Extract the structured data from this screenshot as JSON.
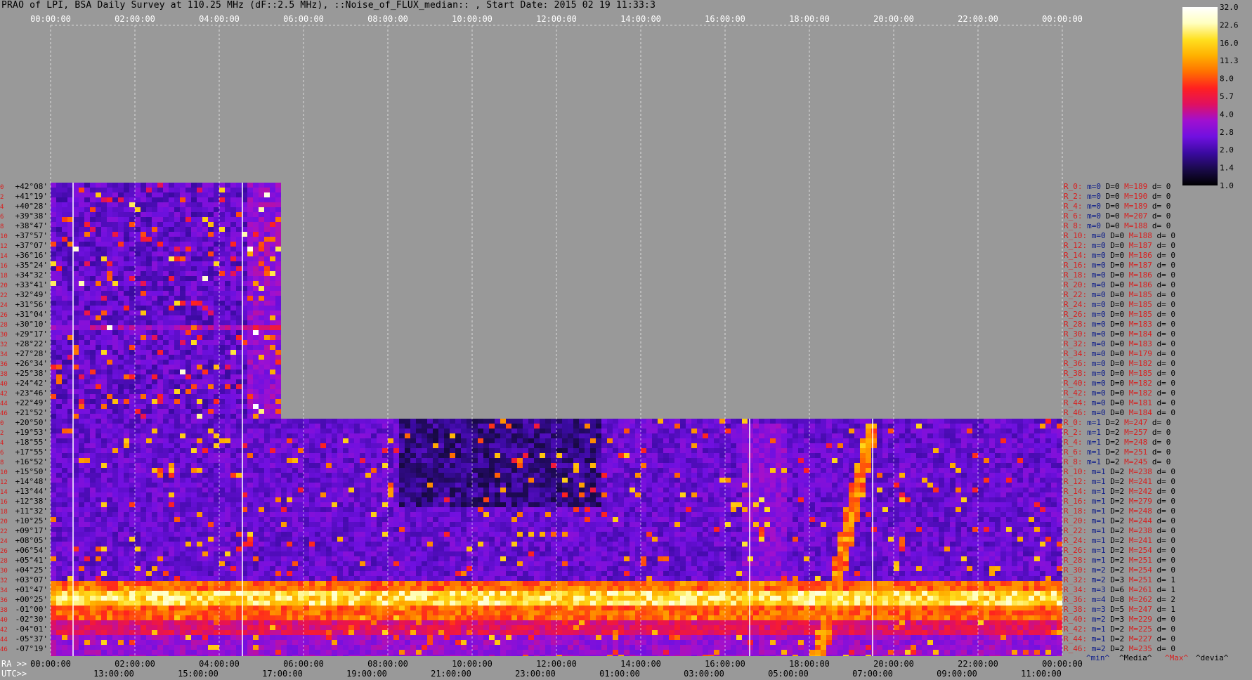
{
  "title": "PRAO of LPI, BSA Daily Survey at 110.25 MHz (dF::2.5 MHz), ::Noise_of_FLUX_median:: , Start Date: 2015 02 19 11:33:3",
  "top_time_labels": [
    "00:00:00",
    "02:00:00",
    "04:00:00",
    "06:00:00",
    "08:00:00",
    "10:00:00",
    "12:00:00",
    "14:00:00",
    "16:00:00",
    "18:00:00",
    "20:00:00",
    "22:00:00",
    "00:00:00"
  ],
  "ra_prefix": "RA >>",
  "ra_labels": [
    "00:00:00",
    "02:00:00",
    "04:00:00",
    "06:00:00",
    "08:00:00",
    "10:00:00",
    "12:00:00",
    "14:00:00",
    "16:00:00",
    "18:00:00",
    "20:00:00",
    "22:00:00",
    "00:00:00"
  ],
  "utc_prefix": "UTC>>",
  "utc_labels": [
    "13:00:00",
    "15:00:00",
    "17:00:00",
    "19:00:00",
    "21:00:00",
    "23:00:00",
    "01:00:00",
    "03:00:00",
    "05:00:00",
    "07:00:00",
    "09:00:00",
    "11:00:00"
  ],
  "colorbar": {
    "ticks": [
      "32.0",
      "22.6",
      "16.0",
      "11.3",
      "8.0",
      "5.7",
      "4.0",
      "2.8",
      "2.0",
      "1.4",
      "1.0"
    ],
    "stops": [
      "#000000",
      "#1a0a4a",
      "#3a0aa0",
      "#7010e0",
      "#a010d0",
      "#e01060",
      "#ff2020",
      "#ff7000",
      "#ffb000",
      "#ffe020",
      "#ffffc0",
      "#ffffff"
    ]
  },
  "declinations_upper": [
    "+42°08'",
    "+41°19'",
    "+40°28'",
    "+39°38'",
    "+38°47'",
    "+37°57'",
    "+37°07'",
    "+36°16'",
    "+35°24'",
    "+34°32'",
    "+33°41'",
    "+32°49'",
    "+31°56'",
    "+31°04'",
    "+30°10'",
    "+29°17'",
    "+28°22'",
    "+27°28'",
    "+26°34'",
    "+25°38'",
    "+24°42'",
    "+23°46'",
    "+22°49'",
    "+21°52'"
  ],
  "declinations_lower": [
    "+20°50'",
    "+19°53'",
    "+18°55'",
    "+17°55'",
    "+16°52'",
    "+15°50'",
    "+14°48'",
    "+13°44'",
    "+12°38'",
    "+11°32'",
    "+10°25'",
    "+09°17'",
    "+08°05'",
    "+06°54'",
    "+05°41'",
    "+04°25'",
    "+03°07'",
    "+01°47'",
    "+00°25'",
    "-01°00'",
    "-02°30'",
    "-04°01'",
    "-05°37'",
    "-07°19'"
  ],
  "row_indices_upper": [
    "0",
    "2",
    "4",
    "6",
    "8",
    "10",
    "12",
    "14",
    "16",
    "18",
    "20",
    "22",
    "24",
    "26",
    "28",
    "30",
    "32",
    "34",
    "36",
    "38",
    "40",
    "42",
    "44",
    "46"
  ],
  "row_indices_lower": [
    "0",
    "2",
    "4",
    "6",
    "8",
    "10",
    "12",
    "14",
    "16",
    "18",
    "20",
    "22",
    "24",
    "26",
    "28",
    "30",
    "32",
    "34",
    "36",
    "38",
    "40",
    "42",
    "44",
    "46"
  ],
  "stats_upper": [
    {
      "r": "R_0:",
      "m": "m=0",
      "D": "D=0",
      "M": "M=189",
      "d": "d= 0"
    },
    {
      "r": "R_2:",
      "m": "m=0",
      "D": "D=0",
      "M": "M=190",
      "d": "d= 0"
    },
    {
      "r": "R_4:",
      "m": "m=0",
      "D": "D=0",
      "M": "M=189",
      "d": "d= 0"
    },
    {
      "r": "R_6:",
      "m": "m=0",
      "D": "D=0",
      "M": "M=207",
      "d": "d= 0"
    },
    {
      "r": "R_8:",
      "m": "m=0",
      "D": "D=0",
      "M": "M=188",
      "d": "d= 0"
    },
    {
      "r": "R_10:",
      "m": "m=0",
      "D": "D=0",
      "M": "M=188",
      "d": "d= 0"
    },
    {
      "r": "R_12:",
      "m": "m=0",
      "D": "D=0",
      "M": "M=187",
      "d": "d= 0"
    },
    {
      "r": "R_14:",
      "m": "m=0",
      "D": "D=0",
      "M": "M=186",
      "d": "d= 0"
    },
    {
      "r": "R_16:",
      "m": "m=0",
      "D": "D=0",
      "M": "M=187",
      "d": "d= 0"
    },
    {
      "r": "R_18:",
      "m": "m=0",
      "D": "D=0",
      "M": "M=186",
      "d": "d= 0"
    },
    {
      "r": "R_20:",
      "m": "m=0",
      "D": "D=0",
      "M": "M=186",
      "d": "d= 0"
    },
    {
      "r": "R_22:",
      "m": "m=0",
      "D": "D=0",
      "M": "M=185",
      "d": "d= 0"
    },
    {
      "r": "R_24:",
      "m": "m=0",
      "D": "D=0",
      "M": "M=185",
      "d": "d= 0"
    },
    {
      "r": "R_26:",
      "m": "m=0",
      "D": "D=0",
      "M": "M=185",
      "d": "d= 0"
    },
    {
      "r": "R_28:",
      "m": "m=0",
      "D": "D=0",
      "M": "M=183",
      "d": "d= 0"
    },
    {
      "r": "R_30:",
      "m": "m=0",
      "D": "D=0",
      "M": "M=184",
      "d": "d= 0"
    },
    {
      "r": "R_32:",
      "m": "m=0",
      "D": "D=0",
      "M": "M=183",
      "d": "d= 0"
    },
    {
      "r": "R_34:",
      "m": "m=0",
      "D": "D=0",
      "M": "M=179",
      "d": "d= 0"
    },
    {
      "r": "R_36:",
      "m": "m=0",
      "D": "D=0",
      "M": "M=182",
      "d": "d= 0"
    },
    {
      "r": "R_38:",
      "m": "m=0",
      "D": "D=0",
      "M": "M=185",
      "d": "d= 0"
    },
    {
      "r": "R_40:",
      "m": "m=0",
      "D": "D=0",
      "M": "M=182",
      "d": "d= 0"
    },
    {
      "r": "R_42:",
      "m": "m=0",
      "D": "D=0",
      "M": "M=182",
      "d": "d= 0"
    },
    {
      "r": "R_44:",
      "m": "m=0",
      "D": "D=0",
      "M": "M=181",
      "d": "d= 0"
    },
    {
      "r": "R_46:",
      "m": "m=0",
      "D": "D=0",
      "M": "M=184",
      "d": "d= 0"
    }
  ],
  "stats_lower": [
    {
      "r": "R_0:",
      "m": "m=1",
      "D": "D=2",
      "M": "M=247",
      "d": "d= 0"
    },
    {
      "r": "R_2:",
      "m": "m=1",
      "D": "D=2",
      "M": "M=257",
      "d": "d= 0"
    },
    {
      "r": "R_4:",
      "m": "m=1",
      "D": "D=2",
      "M": "M=248",
      "d": "d= 0"
    },
    {
      "r": "R_6:",
      "m": "m=1",
      "D": "D=2",
      "M": "M=251",
      "d": "d= 0"
    },
    {
      "r": "R_8:",
      "m": "m=1",
      "D": "D=2",
      "M": "M=245",
      "d": "d= 0"
    },
    {
      "r": "R_10:",
      "m": "m=1",
      "D": "D=2",
      "M": "M=238",
      "d": "d= 0"
    },
    {
      "r": "R_12:",
      "m": "m=1",
      "D": "D=2",
      "M": "M=241",
      "d": "d= 0"
    },
    {
      "r": "R_14:",
      "m": "m=1",
      "D": "D=2",
      "M": "M=242",
      "d": "d= 0"
    },
    {
      "r": "R_16:",
      "m": "m=1",
      "D": "D=2",
      "M": "M=279",
      "d": "d= 0"
    },
    {
      "r": "R_18:",
      "m": "m=1",
      "D": "D=2",
      "M": "M=248",
      "d": "d= 0"
    },
    {
      "r": "R_20:",
      "m": "m=1",
      "D": "D=2",
      "M": "M=244",
      "d": "d= 0"
    },
    {
      "r": "R_22:",
      "m": "m=1",
      "D": "D=2",
      "M": "M=238",
      "d": "d= 0"
    },
    {
      "r": "R_24:",
      "m": "m=1",
      "D": "D=2",
      "M": "M=241",
      "d": "d= 0"
    },
    {
      "r": "R_26:",
      "m": "m=1",
      "D": "D=2",
      "M": "M=254",
      "d": "d= 0"
    },
    {
      "r": "R_28:",
      "m": "m=1",
      "D": "D=2",
      "M": "M=251",
      "d": "d= 0"
    },
    {
      "r": "R_30:",
      "m": "m=2",
      "D": "D=2",
      "M": "M=254",
      "d": "d= 0"
    },
    {
      "r": "R_32:",
      "m": "m=2",
      "D": "D=3",
      "M": "M=251",
      "d": "d= 1"
    },
    {
      "r": "R_34:",
      "m": "m=3",
      "D": "D=6",
      "M": "M=261",
      "d": "d= 1"
    },
    {
      "r": "R_36:",
      "m": "m=4",
      "D": "D=8",
      "M": "M=262",
      "d": "d= 2"
    },
    {
      "r": "R_38:",
      "m": "m=3",
      "D": "D=5",
      "M": "M=247",
      "d": "d= 1"
    },
    {
      "r": "R_40:",
      "m": "m=2",
      "D": "D=3",
      "M": "M=229",
      "d": "d= 0"
    },
    {
      "r": "R_42:",
      "m": "m=1",
      "D": "D=2",
      "M": "M=225",
      "d": "d= 0"
    },
    {
      "r": "R_44:",
      "m": "m=1",
      "D": "D=2",
      "M": "M=227",
      "d": "d= 0"
    },
    {
      "r": "R_46:",
      "m": "m=2",
      "D": "D=2",
      "M": "M=235",
      "d": "d= 0"
    }
  ],
  "footer_legend": {
    "min": "^min^",
    "media": "^Media^",
    "max": "^Max^",
    "devia": "^devia^"
  },
  "chart_data": {
    "type": "heatmap",
    "title": "PRAO of LPI, BSA Daily Survey at 110.25 MHz (dF::2.5 MHz), ::Noise_of_FLUX_median:: , Start Date: 2015 02 19 11:33:3",
    "x_axis_ra": [
      "00:00:00",
      "02:00:00",
      "04:00:00",
      "06:00:00",
      "08:00:00",
      "10:00:00",
      "12:00:00",
      "14:00:00",
      "16:00:00",
      "18:00:00",
      "20:00:00",
      "22:00:00",
      "00:00:00"
    ],
    "x_axis_utc": [
      "13:00:00",
      "15:00:00",
      "17:00:00",
      "19:00:00",
      "21:00:00",
      "23:00:00",
      "01:00:00",
      "03:00:00",
      "05:00:00",
      "07:00:00",
      "09:00:00",
      "11:00:00"
    ],
    "colorbar_range": [
      1.0,
      32.0
    ],
    "colorbar_scale": "log",
    "upper_block": {
      "dec_range": [
        "+42°08'",
        "+21°52'"
      ],
      "ra_range": [
        "00:00:00",
        "05:27:00"
      ]
    },
    "lower_block": {
      "dec_range": [
        "+20°50'",
        "-07°19'"
      ],
      "ra_range": [
        "00:00:00",
        "24:00:00"
      ]
    },
    "bright_band_dec": [
      "+01°47'",
      "-01°00'"
    ],
    "grid": true
  }
}
